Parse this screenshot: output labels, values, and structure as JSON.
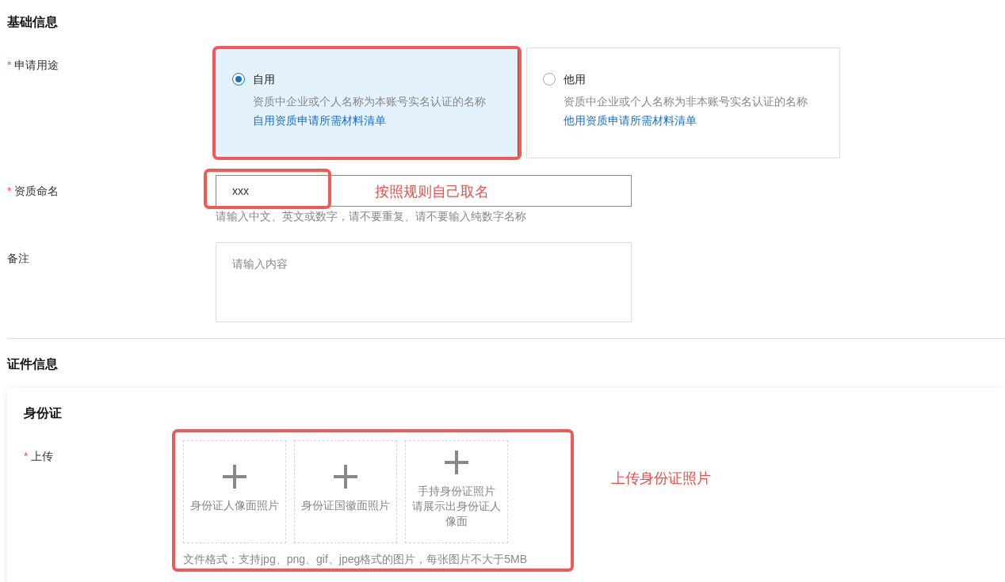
{
  "basic": {
    "title": "基础信息",
    "purpose": {
      "mark": "*",
      "label": "申请用途",
      "options": [
        {
          "title": "自用",
          "description": "资质中企业或个人名称为本账号实名认证的名称",
          "link": "自用资质申请所需材料清单",
          "selected": true,
          "highlighted": true
        },
        {
          "title": "他用",
          "description": "资质中企业或个人名称为非本账号实名认证的名称",
          "link": "他用资质申请所需材料清单",
          "selected": false,
          "highlighted": false
        }
      ]
    },
    "name": {
      "mark": "*",
      "label": "资质命名",
      "value": "xxx",
      "highlighted": true,
      "note": "按照规则自己取名",
      "hint": "请输入中文、英文或数字，请不要重复、请不要输入纯数字名称"
    },
    "remark": {
      "label": "备注",
      "placeholder": "请输入内容"
    }
  },
  "certificate": {
    "title": "证件信息",
    "card": {
      "title": "身份证",
      "upload": {
        "mark": "*",
        "label": "上传",
        "highlighted": true,
        "note": "上传身份证照片",
        "tiles": [
          {
            "lines": [
              "身份证人像面照片"
            ]
          },
          {
            "lines": [
              "身份证国徽面照片"
            ]
          },
          {
            "lines": [
              "手持身份证照片",
              "请展示出身份证人像面"
            ]
          }
        ],
        "format": "文件格式：支持jpg、png、gif、jpeg格式的图片，每张图片不大于5MB"
      }
    }
  }
}
